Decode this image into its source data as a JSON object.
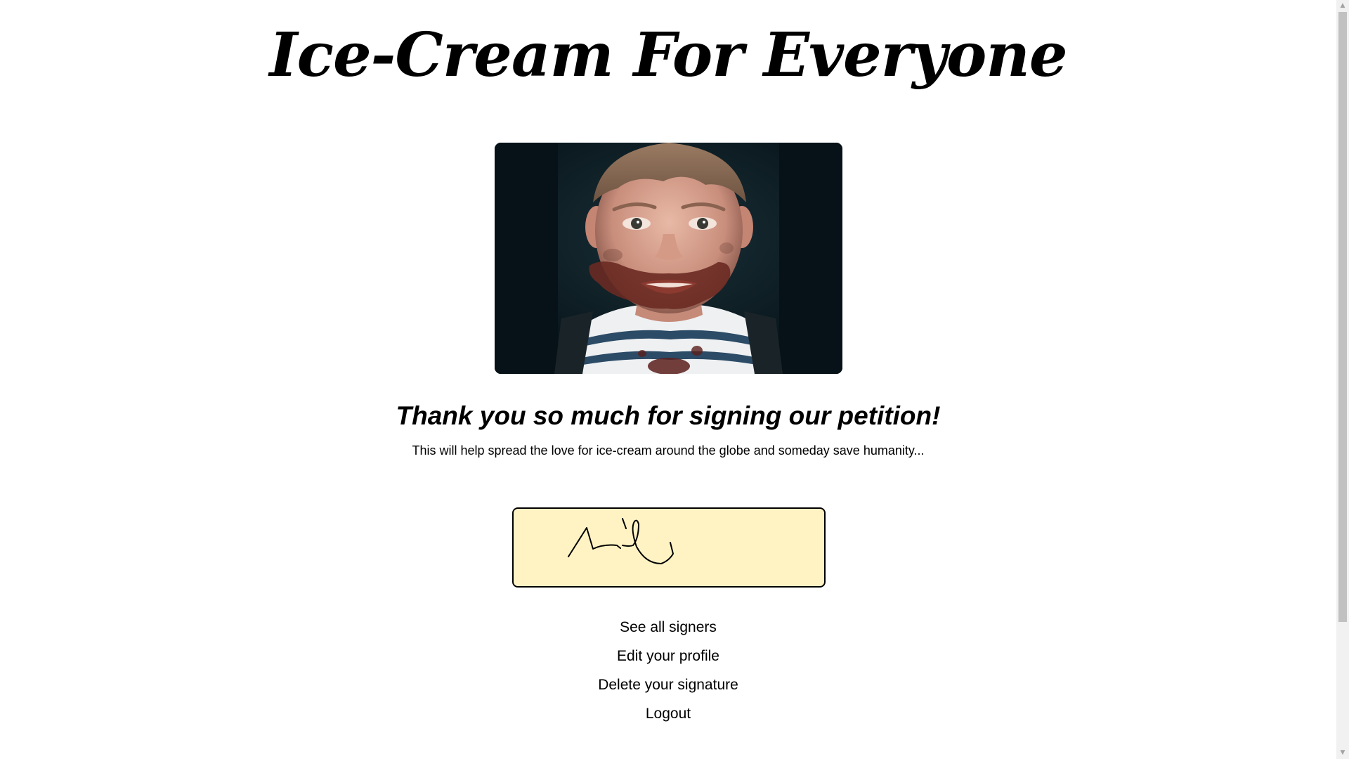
{
  "header": {
    "title": "Ice-Cream For Everyone"
  },
  "main": {
    "heading": "Thank you so much for signing our petition!",
    "subtext": "This will help spread the love for ice-cream around the globe and someday save humanity..."
  },
  "signature": {
    "background_color": "#fff3c4"
  },
  "links": [
    {
      "label": "See all signers"
    },
    {
      "label": "Edit your profile"
    },
    {
      "label": "Delete your signature"
    },
    {
      "label": "Logout"
    }
  ],
  "scrollbar": {
    "up_icon": "triangle-up",
    "down_icon": "triangle-down"
  }
}
